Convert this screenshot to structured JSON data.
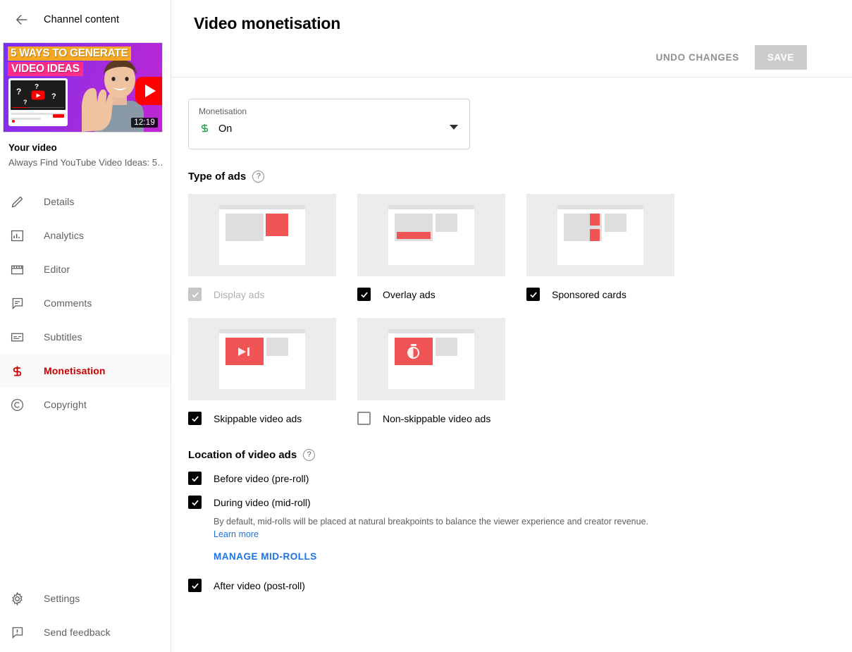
{
  "sidebar": {
    "header_title": "Channel content",
    "back_icon": "back-arrow-icon",
    "video": {
      "duration": "12:19",
      "title": "Your video",
      "subtitle": "Always Find YouTube Video Ideas: 5…",
      "thumb_line1": "5 WAYS TO GENERATE",
      "thumb_line2": "VIDEO IDEAS"
    },
    "items": [
      {
        "label": "Details",
        "icon": "pencil-icon",
        "active": false
      },
      {
        "label": "Analytics",
        "icon": "bar-chart-icon",
        "active": false
      },
      {
        "label": "Editor",
        "icon": "clapperboard-icon",
        "active": false
      },
      {
        "label": "Comments",
        "icon": "comment-icon",
        "active": false
      },
      {
        "label": "Subtitles",
        "icon": "subtitles-icon",
        "active": false
      },
      {
        "label": "Monetisation",
        "icon": "dollar-icon",
        "active": true
      },
      {
        "label": "Copyright",
        "icon": "copyright-icon",
        "active": false
      }
    ],
    "bottom_items": [
      {
        "label": "Settings",
        "icon": "gear-icon"
      },
      {
        "label": "Send feedback",
        "icon": "feedback-icon"
      }
    ],
    "active_color": "#cc0000"
  },
  "header": {
    "title": "Video monetisation",
    "undo_label": "UNDO CHANGES",
    "save_label": "SAVE"
  },
  "monetisation_select": {
    "label": "Monetisation",
    "value": "On",
    "icon": "dollar-icon",
    "icon_color": "#2ba24c",
    "caret_icon": "chevron-down-icon"
  },
  "type_of_ads": {
    "title": "Type of ads",
    "help_icon": "help-circle-icon",
    "options": [
      {
        "label": "Display ads",
        "state": "disabled-checked",
        "preview": "display-ads-preview"
      },
      {
        "label": "Overlay ads",
        "state": "checked",
        "preview": "overlay-ads-preview"
      },
      {
        "label": "Sponsored cards",
        "state": "checked",
        "preview": "sponsored-cards-preview"
      },
      {
        "label": "Skippable video ads",
        "state": "checked",
        "preview": "skippable-video-ads-preview"
      },
      {
        "label": "Non-skippable video ads",
        "state": "unchecked",
        "preview": "non-skippable-video-ads-preview"
      }
    ]
  },
  "location_of_video_ads": {
    "title": "Location of video ads",
    "help_icon": "help-circle-icon",
    "options": [
      {
        "label": "Before video (pre-roll)",
        "state": "checked"
      },
      {
        "label": "During video (mid-roll)",
        "state": "checked"
      },
      {
        "label": "After video (post-roll)",
        "state": "checked"
      }
    ],
    "midroll_note": "By default, mid-rolls will be placed at natural breakpoints to balance the viewer experience and creator revenue.",
    "learn_more_label": "Learn more",
    "manage_label": "MANAGE MID-ROLLS",
    "link_color": "#1a73e8"
  }
}
